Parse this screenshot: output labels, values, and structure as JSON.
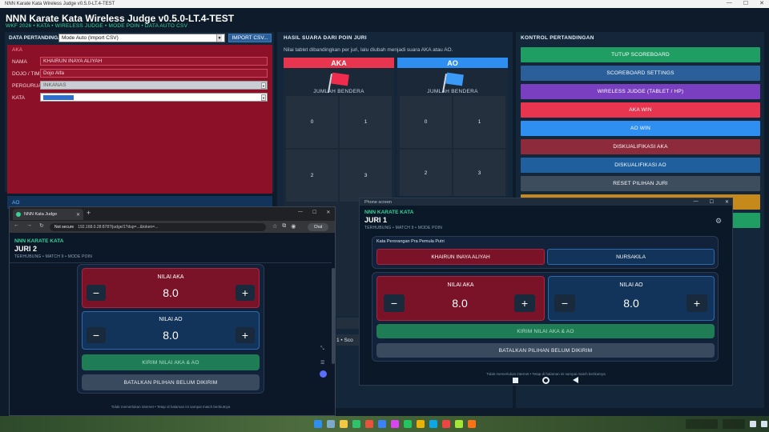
{
  "window": {
    "title": "NNN Karate Kata Wireless Judge v0.5.0-LT.4-TEST",
    "controls": [
      "—",
      "☐",
      "✕"
    ]
  },
  "app": {
    "title": "NNN Karate Kata Wireless Judge v0.5.0-LT.4-TEST",
    "subtitle": "WKF 2026 • KATA • WIRELESS JUDGE • MODE POIN • DATA AUTO CSV"
  },
  "data_pertandingan": {
    "label": "DATA PERTANDINGAN",
    "mode_value": "Mode Auto (Import CSV)",
    "import_button": "IMPORT CSV...",
    "aka_tag": "AKA",
    "fields": {
      "nama_label": "NAMA",
      "nama_value": "KHAIRUN INAYA ALIYAH",
      "dojo_label": "DOJO / TIM",
      "dojo_value": "Dojo Alfa",
      "perguruan_label": "PERGURUAN",
      "perguruan_value": "INKANAS",
      "kata_label": "KATA"
    },
    "ao_tag": "AO"
  },
  "hasil": {
    "title": "HASIL SUARA DARI POIN JURI",
    "note": "Nilai tablet dibandingkan per juri, lalu diubah menjadi suara AKA atau AO.",
    "aka": {
      "label": "AKA",
      "jumlah": "JUMLAH BENDERA",
      "cells": [
        "0",
        "1",
        "2",
        "3"
      ]
    },
    "ao": {
      "label": "AO",
      "jumlah": "JUMLAH BENDERA",
      "cells": [
        "0",
        "1",
        "2",
        "3"
      ]
    },
    "footer_fragment": "1 • Sco"
  },
  "kontrol": {
    "title": "KONTROL PERTANDINGAN",
    "buttons": [
      "TUTUP SCOREBOARD",
      "SCOREBOARD SETTINGS",
      "WIRELESS JUDGE (TABLET / HP)",
      "AKA WIN",
      "AO WIN",
      "DISKUALIFIKASI AKA",
      "DISKUALIFIKASI AO",
      "RESET PILIHAN JURI"
    ]
  },
  "juri1": {
    "window_title": "Phone screen",
    "app_tag": "NNN KARATE KATA",
    "title": "JURI 1",
    "subtitle": "TERHUBUNG • MATCH 9 • MODE POIN",
    "category": "Kata Perorangan Pra Pemula Putri",
    "aka_name": "KHAIRUN INAYA ALIYAH",
    "ao_name": "NURSAKILA",
    "nilai_aka_label": "NILAI AKA",
    "nilai_aka": "8.0",
    "nilai_ao_label": "NILAI AO",
    "nilai_ao": "8.0",
    "minus": "−",
    "plus": "+",
    "kirim": "KIRIM NILAI AKA & AO",
    "batalkan": "BATALKAN PILIHAN BELUM DIKIRIM",
    "footer": "Tidak memerlukan internet • Tetap di halaman ini sampai match berikutnya"
  },
  "browser": {
    "tab_title": "NNN Kata Judge",
    "new_tab": "+",
    "not_secure": "Not secure",
    "url": "192.168.0.28:8787/judge/1?dsp=...&token=...",
    "chat": "Chat",
    "page": {
      "app_tag": "NNN KARATE KATA",
      "title": "JURI 2",
      "subtitle": "TERHUBUNG • MATCH 9 • MODE POIN",
      "nilai_aka_label": "NILAI AKA",
      "nilai_aka": "8.0",
      "nilai_ao_label": "NILAI AO",
      "nilai_ao": "8.0",
      "minus": "−",
      "plus": "+",
      "kirim": "KIRIM NILAI AKA & AO",
      "batalkan": "BATALKAN PILIHAN BELUM DIKIRIM",
      "footer": "Tidak memerlukan internet • Tetap di halaman ini sampai match berikutnya"
    }
  },
  "colors": {
    "aka_red": "#8b1028",
    "ao_blue": "#12345a",
    "green": "#1f9d63",
    "accent_green": "#36d399"
  }
}
